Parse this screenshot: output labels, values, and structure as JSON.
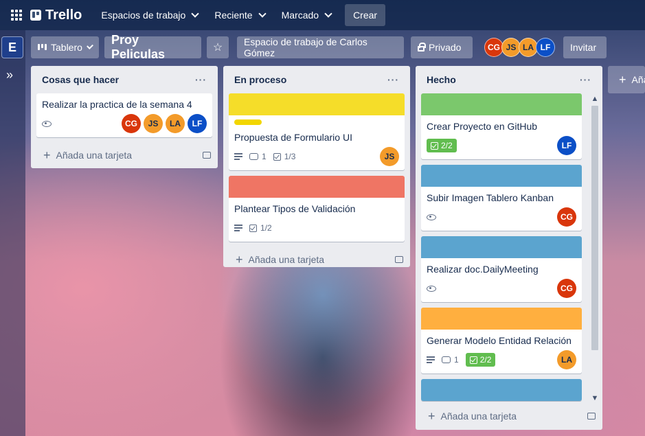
{
  "topbar": {
    "logo_text": "Trello",
    "nav": [
      {
        "label": "Espacios de trabajo"
      },
      {
        "label": "Reciente"
      },
      {
        "label": "Marcado"
      }
    ],
    "create_label": "Crear"
  },
  "sidebar": {
    "workspace_initial": "E",
    "expand_glyph": "»"
  },
  "board": {
    "view_label": "Tablero",
    "title": "Proy Peliculas",
    "workspace_label": "Espacio de trabajo de Carlos Gómez",
    "visibility_label": "Privado",
    "invite_label": "Invitar",
    "members": [
      "CG",
      "JS",
      "LA",
      "LF"
    ]
  },
  "colors": {
    "cover_green": "#7bc86c",
    "cover_red": "#ef7564",
    "cover_blue": "#5ba4cf",
    "cover_orange": "#ffaf3f",
    "cover_yellow": "#f5dd29",
    "label_yellow": "#f2d600"
  },
  "lists": [
    {
      "title": "Cosas que hacer",
      "menu_glyph": "···",
      "add_card_label": "Añada una tarjeta",
      "cards": [
        {
          "title": "Realizar la practica de la semana 4",
          "members": [
            "CG",
            "JS",
            "LA",
            "LF"
          ]
        }
      ]
    },
    {
      "title": "En proceso",
      "menu_glyph": "···",
      "add_card_label": "Añada una tarjeta",
      "cards": [
        {
          "title": "Propuesta de Formulario UI",
          "comments": "1",
          "checklist": "1/3",
          "members": [
            "JS"
          ]
        },
        {
          "title": "Plantear Tipos de Validación",
          "checklist": "1/2"
        }
      ]
    },
    {
      "title": "Hecho",
      "menu_glyph": "···",
      "add_card_label": "Añada una tarjeta",
      "cards": [
        {
          "title": "Crear Proyecto en GitHub",
          "checklist": "2/2",
          "members": [
            "LF"
          ]
        },
        {
          "title": "Subir Imagen Tablero Kanban",
          "members": [
            "CG"
          ]
        },
        {
          "title": "Realizar doc.DailyMeeting",
          "members": [
            "CG"
          ]
        },
        {
          "title": "Generar Modelo Entidad Relación",
          "comments": "1",
          "checklist": "2/2",
          "members": [
            "LA"
          ]
        }
      ]
    }
  ],
  "add_list_label": "Aña"
}
